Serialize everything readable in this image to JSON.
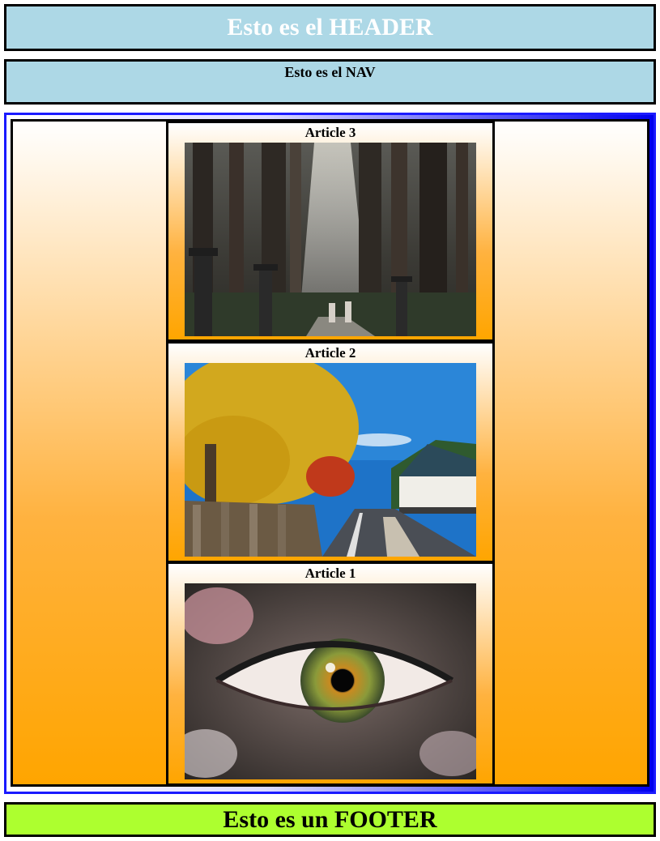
{
  "header": {
    "title": "Esto es el HEADER"
  },
  "nav": {
    "title": "Esto es el NAV"
  },
  "articles": [
    {
      "title": "Article 3",
      "image": "forest-path-photo"
    },
    {
      "title": "Article 2",
      "image": "autumn-street-photo"
    },
    {
      "title": "Article 1",
      "image": "eye-closeup-photo"
    }
  ],
  "footer": {
    "title": "Esto es un FOOTER"
  },
  "colors": {
    "header_bg": "#add8e6",
    "nav_bg": "#add8e6",
    "footer_bg": "#adff2f",
    "section_border": "#1a1aff",
    "main_gradient_end": "#ffa500"
  }
}
